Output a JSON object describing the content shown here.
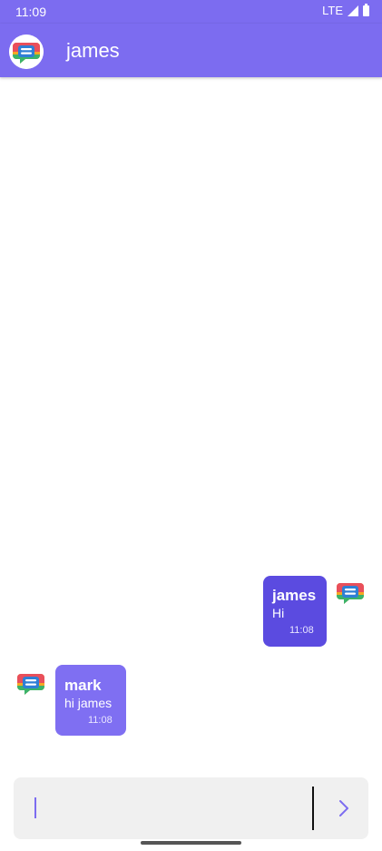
{
  "status_bar": {
    "time": "11:09",
    "network": "LTE",
    "icons": [
      "signal-icon",
      "battery-icon"
    ]
  },
  "app_bar": {
    "title": "james",
    "avatar_icon": "chat-bubble-logo-icon",
    "background_color": "#7c6cf0"
  },
  "messages": [
    {
      "sender": "james",
      "text": "Hi",
      "time": "11:08",
      "direction": "sent",
      "bubble_color": "#5b4be0"
    },
    {
      "sender": "mark",
      "text": "hi james",
      "time": "11:08",
      "direction": "received",
      "bubble_color": "#7f6ff2"
    }
  ],
  "composer": {
    "value": "",
    "placeholder": "",
    "send_icon": "chevron-right-icon",
    "accent_color": "#7c6cf0"
  }
}
